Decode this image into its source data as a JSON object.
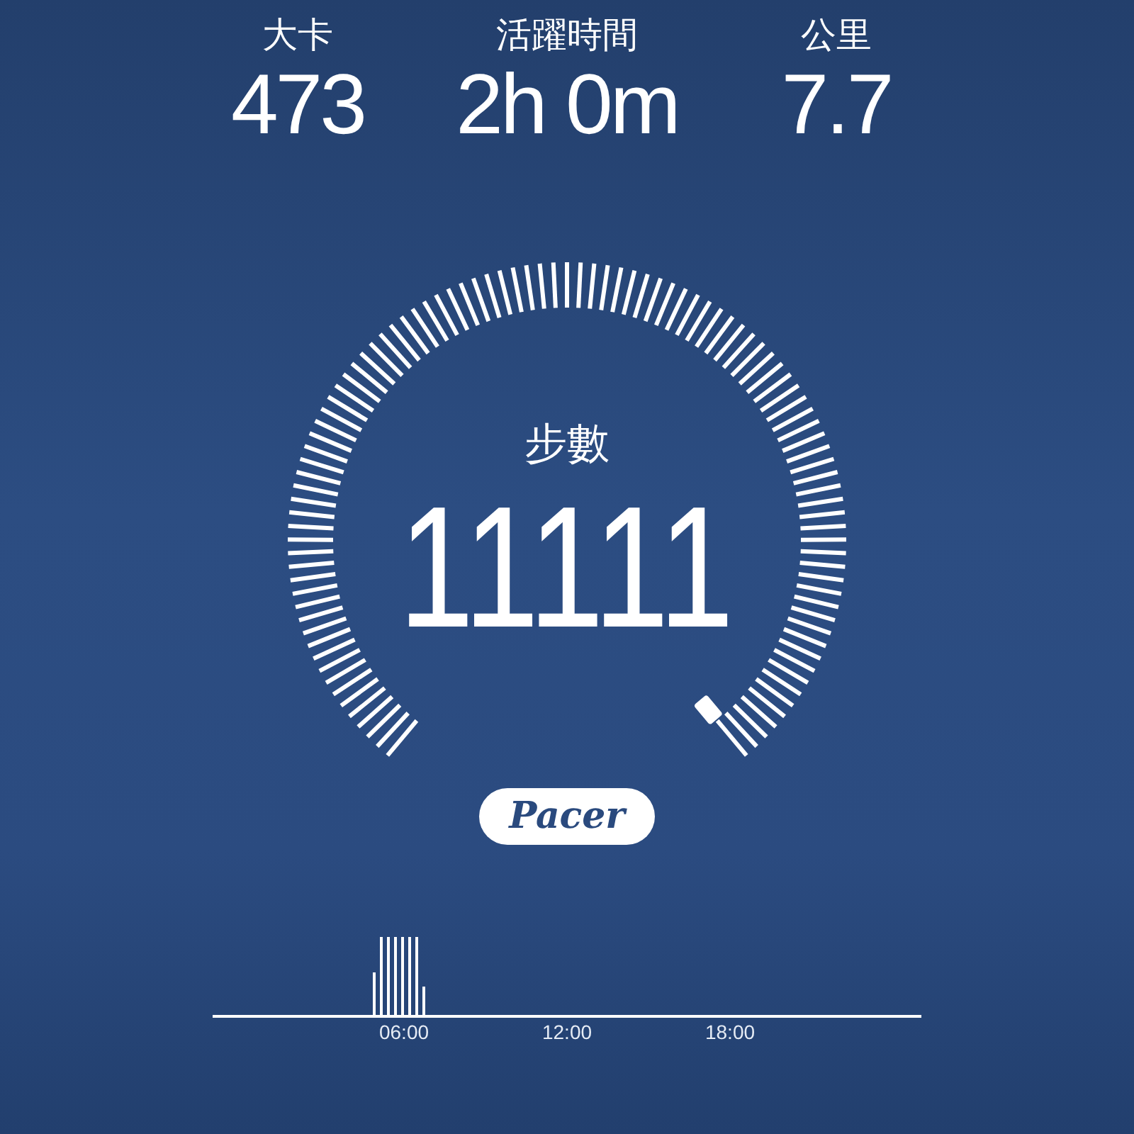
{
  "stats": [
    {
      "label": "大卡",
      "value": "473"
    },
    {
      "label": "活躍時間",
      "value": "2h 0m"
    },
    {
      "label": "公里",
      "value": "7.7"
    }
  ],
  "gauge": {
    "label": "步數",
    "value": "11111"
  },
  "badge": {
    "text": "Pacer"
  },
  "timeline": {
    "ticks": [
      "06:00",
      "12:00",
      "18:00"
    ]
  }
}
